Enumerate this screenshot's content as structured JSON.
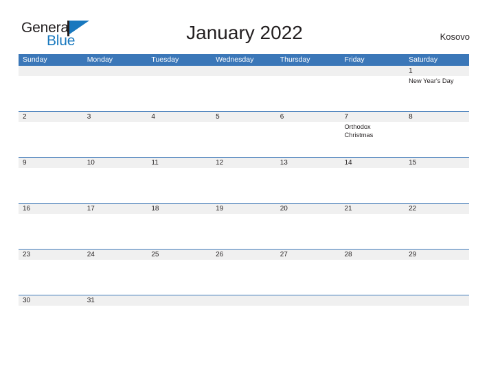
{
  "brand": {
    "name_part1": "General",
    "name_part2": "Blue",
    "flag_icon": "flag-triangle-icon"
  },
  "header": {
    "title": "January 2022",
    "region": "Kosovo"
  },
  "calendar": {
    "weekday_headers": [
      "Sunday",
      "Monday",
      "Tuesday",
      "Wednesday",
      "Thursday",
      "Friday",
      "Saturday"
    ],
    "weeks": [
      {
        "days": [
          {
            "number": "",
            "events": []
          },
          {
            "number": "",
            "events": []
          },
          {
            "number": "",
            "events": []
          },
          {
            "number": "",
            "events": []
          },
          {
            "number": "",
            "events": []
          },
          {
            "number": "",
            "events": []
          },
          {
            "number": "1",
            "events": [
              "New Year's Day"
            ]
          }
        ]
      },
      {
        "days": [
          {
            "number": "2",
            "events": []
          },
          {
            "number": "3",
            "events": []
          },
          {
            "number": "4",
            "events": []
          },
          {
            "number": "5",
            "events": []
          },
          {
            "number": "6",
            "events": []
          },
          {
            "number": "7",
            "events": [
              "Orthodox",
              "Christmas"
            ]
          },
          {
            "number": "8",
            "events": []
          }
        ]
      },
      {
        "days": [
          {
            "number": "9",
            "events": []
          },
          {
            "number": "10",
            "events": []
          },
          {
            "number": "11",
            "events": []
          },
          {
            "number": "12",
            "events": []
          },
          {
            "number": "13",
            "events": []
          },
          {
            "number": "14",
            "events": []
          },
          {
            "number": "15",
            "events": []
          }
        ]
      },
      {
        "days": [
          {
            "number": "16",
            "events": []
          },
          {
            "number": "17",
            "events": []
          },
          {
            "number": "18",
            "events": []
          },
          {
            "number": "19",
            "events": []
          },
          {
            "number": "20",
            "events": []
          },
          {
            "number": "21",
            "events": []
          },
          {
            "number": "22",
            "events": []
          }
        ]
      },
      {
        "days": [
          {
            "number": "23",
            "events": []
          },
          {
            "number": "24",
            "events": []
          },
          {
            "number": "25",
            "events": []
          },
          {
            "number": "26",
            "events": []
          },
          {
            "number": "27",
            "events": []
          },
          {
            "number": "28",
            "events": []
          },
          {
            "number": "29",
            "events": []
          }
        ]
      },
      {
        "days": [
          {
            "number": "30",
            "events": []
          },
          {
            "number": "31",
            "events": []
          },
          {
            "number": "",
            "events": []
          },
          {
            "number": "",
            "events": []
          },
          {
            "number": "",
            "events": []
          },
          {
            "number": "",
            "events": []
          },
          {
            "number": "",
            "events": []
          }
        ]
      }
    ]
  },
  "colors": {
    "header_blue": "#3b77b8",
    "brand_blue": "#1878be",
    "row_divider": "#3b77b8",
    "day_band": "#f0f0f0",
    "text_dark": "#231f20"
  }
}
